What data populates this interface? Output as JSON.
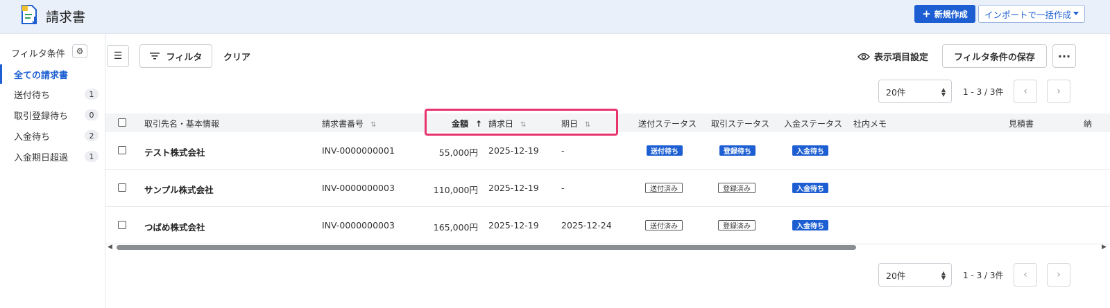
{
  "header": {
    "title": "請求書",
    "new_button": "新規作成",
    "import_button": "インポートで一括作成"
  },
  "sidebar": {
    "heading": "フィルタ条件",
    "items": [
      {
        "label": "全ての請求書",
        "count": ""
      },
      {
        "label": "送付待ち",
        "count": "1"
      },
      {
        "label": "取引登録待ち",
        "count": "0"
      },
      {
        "label": "入金待ち",
        "count": "2"
      },
      {
        "label": "入金期日超過",
        "count": "1"
      }
    ]
  },
  "toolbar": {
    "filter": "フィルタ",
    "clear": "クリア",
    "columns": "表示項目設定",
    "save_filter": "フィルタ条件の保存"
  },
  "pagination": {
    "per_page": "20件",
    "range": "1 - 3 / 3件"
  },
  "columns": {
    "client": "取引先名・基本情報",
    "invoice_no": "請求書番号",
    "amount": "金額",
    "invoice_date": "請求日",
    "due_date": "期日",
    "send_status": "送付ステータス",
    "deal_status": "取引ステータス",
    "payment_status": "入金ステータス",
    "memo": "社内メモ",
    "quote": "見積書",
    "cut": "納"
  },
  "rows": [
    {
      "client": "テスト株式会社",
      "invoice_no": "INV-0000000001",
      "amount": "55,000円",
      "invoice_date": "2025-12-19",
      "due_date": "-",
      "send_status": "送付待ち",
      "send_filled": true,
      "deal_status": "登録待ち",
      "deal_filled": true,
      "payment_status": "入金待ち"
    },
    {
      "client": "サンプル株式会社",
      "invoice_no": "INV-0000000003",
      "amount": "110,000円",
      "invoice_date": "2025-12-19",
      "due_date": "-",
      "send_status": "送付済み",
      "send_filled": false,
      "deal_status": "登録済み",
      "deal_filled": false,
      "payment_status": "入金待ち"
    },
    {
      "client": "つばめ株式会社",
      "invoice_no": "INV-0000000003",
      "amount": "165,000円",
      "invoice_date": "2025-12-19",
      "due_date": "2025-12-24",
      "send_status": "送付済み",
      "send_filled": false,
      "deal_status": "登録済み",
      "deal_filled": false,
      "payment_status": "入金待ち"
    }
  ],
  "colors": {
    "accent": "#1d5fd2",
    "highlight": "#e8336d"
  }
}
